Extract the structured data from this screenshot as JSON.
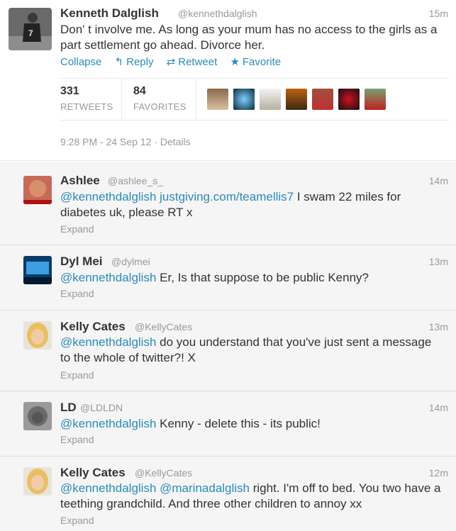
{
  "main_tweet": {
    "name": "Kenneth Dalglish",
    "handle": "@kennethdalglish",
    "time": "15m",
    "text": "Don' t involve me. As long as your mum has no access to the girls as a part settlement go ahead. Divorce her.",
    "actions": {
      "collapse": "Collapse",
      "reply": "Reply",
      "retweet": "Retweet",
      "favorite": "Favorite"
    },
    "stats": {
      "retweets_count": "331",
      "retweets_label": "RETWEETS",
      "favorites_count": "84",
      "favorites_label": "FAVORITES"
    },
    "date": "9:28 PM - 24 Sep 12 · Details"
  },
  "replies": [
    {
      "name": "Ashlee",
      "handle": "@ashlee_s_",
      "time": "14m",
      "mention": "@kennethdalglish",
      "link": "justgiving.com/teamellis7",
      "text": " I swam 22 miles for diabetes uk, please RT x",
      "expand": "Expand"
    },
    {
      "name": "Dyl Mei",
      "handle": "@dylmei",
      "time": "13m",
      "mention": "@kennethdalglish",
      "text": " Er, Is that suppose to be public Kenny?",
      "expand": "Expand"
    },
    {
      "name": "Kelly Cates",
      "handle": "@KellyCates",
      "time": "13m",
      "mention": "@kennethdalglish",
      "text": " do you understand that you've just sent a message to the whole of twitter?! X",
      "expand": "Expand"
    },
    {
      "name": "LD",
      "handle": "@LDLDN",
      "time": "14m",
      "mention": "@kennethdalglish",
      "text": " Kenny - delete this - its public!",
      "expand": "Expand"
    },
    {
      "name": "Kelly Cates",
      "handle": "@KellyCates",
      "time": "12m",
      "mention": "@kennethdalglish",
      "mention2": "@marinadalglish",
      "text": " right. I'm off to bed. You two have a teething grandchild. And three other children to annoy xx",
      "expand": "Expand"
    }
  ],
  "colors": {
    "link": "#2a8bbb",
    "meta": "#999999",
    "reply_bg": "#f5f5f5"
  }
}
